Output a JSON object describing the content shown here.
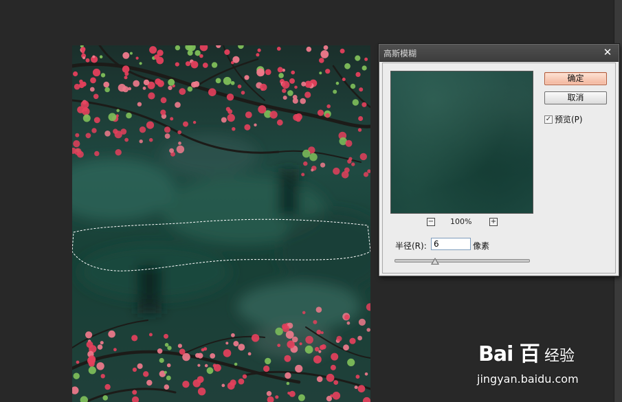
{
  "dialog": {
    "title": "高斯模糊",
    "close": "✕",
    "ok_label": "确定",
    "cancel_label": "取消",
    "preview_label": "预览(P)",
    "preview_checked": "✓",
    "zoom_minus": "−",
    "zoom_level": "100%",
    "zoom_plus": "+",
    "radius_label": "半径(R):",
    "radius_value": "6",
    "radius_unit": "像素",
    "radius_slider_fraction": 0.3
  },
  "watermark": {
    "logo": "Bai 百",
    "service": "经验",
    "url": "jingyan.baidu.com"
  },
  "colors": {
    "background": "#282828",
    "dialog": "#ececec",
    "ok_button": "#f3b49b",
    "foliage": "#1e4a42",
    "blossom": "#e4405c"
  }
}
